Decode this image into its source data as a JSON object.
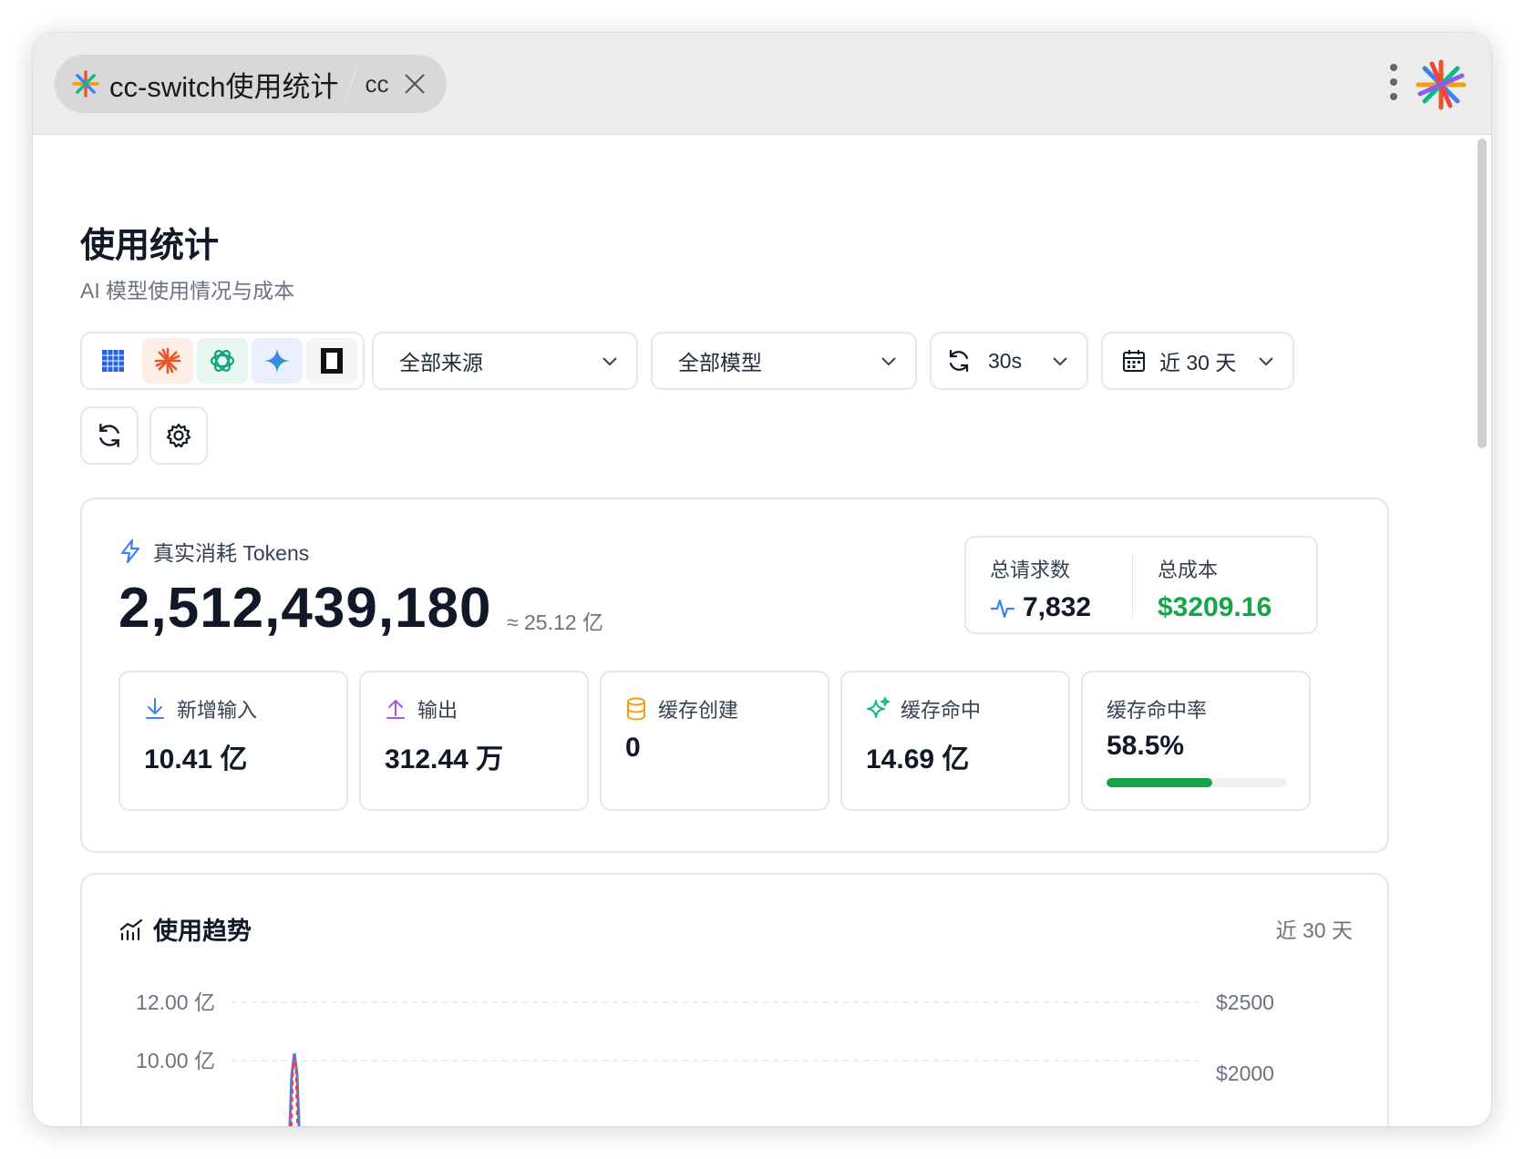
{
  "window": {
    "tab_title": "cc-switch使用统计",
    "tab_sub": "cc"
  },
  "page": {
    "title": "使用统计",
    "subtitle": "AI 模型使用情况与成本"
  },
  "toolbar": {
    "source_select": "全部来源",
    "model_select": "全部模型",
    "refresh_interval": "30s",
    "date_range": "近 30 天"
  },
  "tokens": {
    "label": "真实消耗 Tokens",
    "total": "2,512,439,180",
    "approx": "≈ 25.12 亿"
  },
  "summary": {
    "requests_label": "总请求数",
    "requests_value": "7,832",
    "cost_label": "总成本",
    "cost_value": "$3209.16"
  },
  "metrics": [
    {
      "label": "新增输入",
      "value": "10.41 亿"
    },
    {
      "label": "输出",
      "value": "312.44 万"
    },
    {
      "label": "缓存创建",
      "value": "0"
    },
    {
      "label": "缓存命中",
      "value": "14.69 亿"
    },
    {
      "label": "缓存命中率",
      "value": "58.5%",
      "progress": 0.585
    }
  ],
  "trend": {
    "title": "使用趋势",
    "range": "近 30 天"
  },
  "chart_data": {
    "type": "line",
    "left_ticks": [
      {
        "label": "12.00 亿",
        "value": 12
      },
      {
        "label": "10.00 亿",
        "value": 10
      }
    ],
    "right_ticks": [
      {
        "label": "$2500",
        "value": 2500
      },
      {
        "label": "$2000",
        "value": 2000
      }
    ],
    "ylim_left": [
      10,
      12
    ],
    "series": [
      {
        "color": "#3b82f6"
      },
      {
        "color": "#ef4444"
      }
    ],
    "grid": true
  },
  "colors": {
    "accent_blue": "#3b82f6",
    "cost_green": "#16a34a",
    "progress_green": "#16a34a",
    "claude_orange": "#e8572a"
  }
}
